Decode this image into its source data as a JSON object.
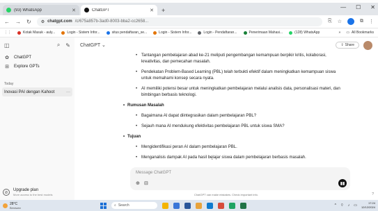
{
  "colors": {
    "tabbar_bg": "#e3e6ea",
    "whatsapp_green": "#25d366",
    "chatgpt_black": "#111111",
    "taskbar_bg": "#dfe6ef",
    "windows_blue": "#1b6fd6"
  },
  "browser": {
    "tabs": [
      {
        "label": "(93) WhatsApp",
        "icon": "whatsapp-icon"
      },
      {
        "label": "ChatGPT",
        "icon": "chatgpt-icon"
      }
    ],
    "url_host": "chatgpt.com",
    "url_path": "/c/675a857b-3ad0-8003-bba2-cc2658...",
    "bookmarks": [
      "Kotak Masuk - auly...",
      "Login - Sistem Infor...",
      "situs pendaftaran_se...",
      "Login - Sistem Infor...",
      "Login - Pendaftaran...",
      "Penerimaan Mahasi...",
      "(128) WhatsApp"
    ],
    "all_bookmarks": "All Bookmarks"
  },
  "sidebar": {
    "items": [
      {
        "label": "ChatGPT",
        "icon": "chatgpt-icon"
      },
      {
        "label": "Explore GPTs",
        "icon": "grid-icon"
      }
    ],
    "section_today": "Today",
    "active_chat": "Inovasi PAI dengan Kahoot",
    "upgrade_title": "Upgrade plan",
    "upgrade_sub": "More access to the best models"
  },
  "main": {
    "model_label": "ChatGPT",
    "share_label": "Share",
    "bullets_top": [
      "Tantangan pembelajaran abad ke-21 meliputi pengembangan kemampuan berpikir kritis, kolaborasi, kreativitas, dan pemecahan masalah.",
      "Pendekatan Problem-Based Learning (PBL) telah terbukti efektif dalam meningkatkan kemampuan siswa untuk memahami konsep secara nyata.",
      "AI memiliki potensi besar untuk meningkatkan pembelajaran melalui analisis data, personalisasi materi, dan bimbingan berbasis teknologi."
    ],
    "section_rumusan": "Rumusan Masalah",
    "bullets_rumusan": [
      "Bagaimana AI dapat diintegrasikan dalam pembelajaran PBL?",
      "Sejauh mana AI mendukung efektivitas pembelajaran PBL untuk siswa SMA?"
    ],
    "section_tujuan": "Tujuan",
    "bullets_tujuan": [
      "Mengidentifikasi peran AI dalam pembelajaran PBL.",
      "Menganalisis dampak AI pada hasil belajar siswa dalam pembelajaran berbasis masalah."
    ],
    "composer_placeholder": "Message ChatGPT",
    "disclaimer": "ChatGPT can make mistakes. Check important info.",
    "help": "?"
  },
  "taskbar": {
    "temp": "28°C",
    "weather": "Berawan",
    "search": "Search",
    "time": "17:24",
    "date": "12/12/2024"
  }
}
